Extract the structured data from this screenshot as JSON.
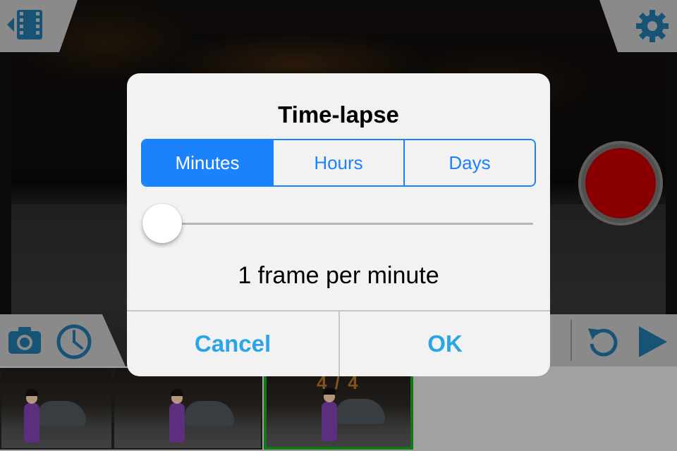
{
  "dialog": {
    "title": "Time-lapse",
    "segments": [
      "Minutes",
      "Hours",
      "Days"
    ],
    "selected_segment": "Minutes",
    "slider": {
      "value": 0
    },
    "rate_text": "1 frame per minute",
    "cancel_label": "Cancel",
    "ok_label": "OK"
  },
  "filmstrip": {
    "counter": "4 / 4",
    "selected_frame": 3
  },
  "icons": {
    "top_left": "back-film-icon",
    "top_right": "gear-icon",
    "bottom_left": [
      "camera-icon",
      "clock-icon"
    ],
    "bottom_right": [
      "undo-icon",
      "play-icon"
    ],
    "record": "record-button"
  },
  "colors": {
    "accent_blue": "#1a82fb",
    "button_text_blue": "#29a5e8",
    "toolbar_icon_blue": "#1f6f9c",
    "record_red": "#b80000",
    "selected_frame_green": "#1a9f1a"
  }
}
